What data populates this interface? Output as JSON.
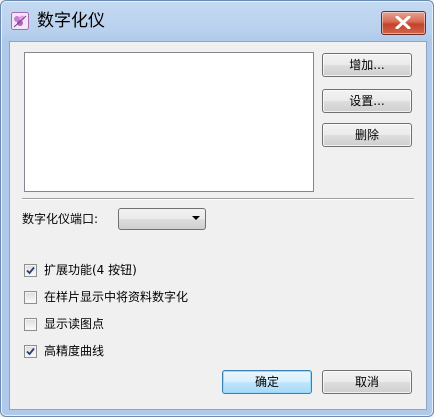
{
  "window": {
    "title": "数字化仪",
    "close_icon": "close-x-icon",
    "app_icon": "digitizer-app-icon"
  },
  "buttons": {
    "add": "增加...",
    "settings": "设置...",
    "delete": "删除",
    "ok": "确定",
    "cancel": "取消"
  },
  "port": {
    "label": "数字化仪端口:",
    "selected": ""
  },
  "options": [
    {
      "label": "扩展功能(4 按钮)",
      "checked": true
    },
    {
      "label": "在样片显示中将资料数字化",
      "checked": false
    },
    {
      "label": "显示读图点",
      "checked": false
    },
    {
      "label": "高精度曲线",
      "checked": true
    }
  ],
  "colors": {
    "titlebar": "#b9d1ee",
    "close_button": "#c4432a",
    "default_button_border": "#3c7fb1"
  }
}
